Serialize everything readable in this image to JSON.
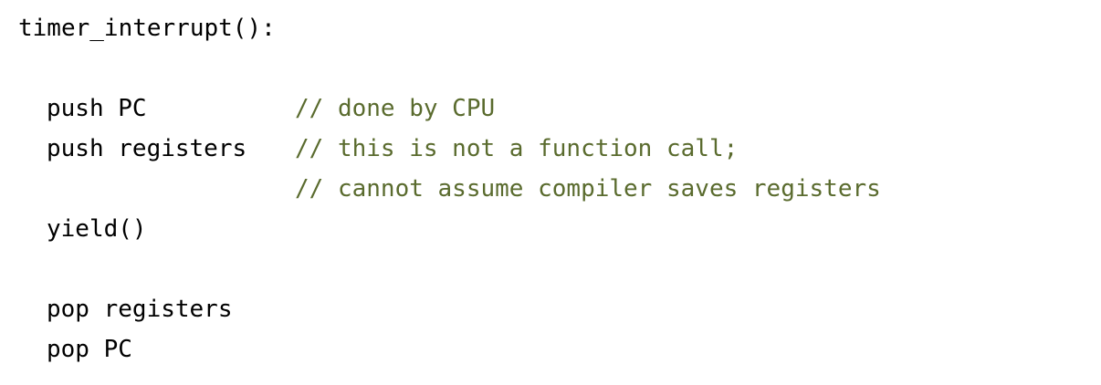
{
  "code": {
    "function_header": "timer_interrupt():",
    "lines": [
      {
        "statement": "push PC",
        "comment": "// done by CPU"
      },
      {
        "statement": "push registers",
        "comment": "// this is not a function call;"
      },
      {
        "statement": "",
        "comment": "// cannot assume compiler saves registers"
      },
      {
        "statement": "yield()",
        "comment": ""
      },
      {
        "statement": "pop registers",
        "comment": ""
      },
      {
        "statement": "pop PC",
        "comment": ""
      }
    ]
  },
  "colors": {
    "text": "#000000",
    "comment": "#5a6b2e",
    "background": "#ffffff"
  }
}
